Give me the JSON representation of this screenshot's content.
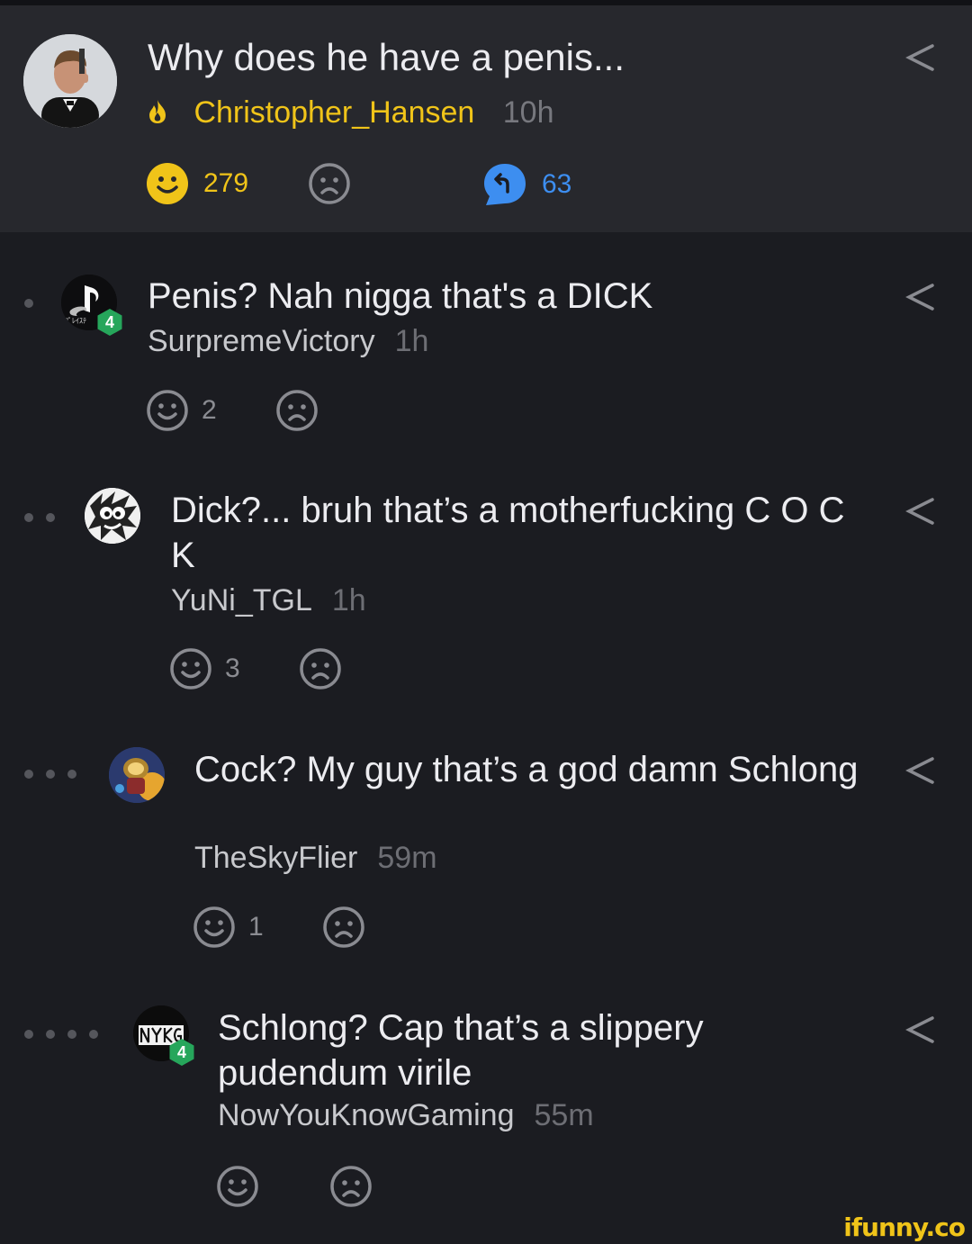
{
  "post": {
    "title": "Why does he have a penis...",
    "author": "Christopher_Hansen",
    "time": "10h",
    "smiles": "279",
    "replies": "63"
  },
  "comments": [
    {
      "text": "Penis? Nah nigga that's a DICK",
      "user": "SurpremeVictory",
      "time": "1h",
      "smiles": "2",
      "badge": "4",
      "depth": 1
    },
    {
      "text": "Dick?... bruh that’s a motherfucking C O C K",
      "user": "YuNi_TGL",
      "time": "1h",
      "smiles": "3",
      "badge": "",
      "depth": 2
    },
    {
      "text": "Cock? My guy that’s a god damn Schlong",
      "user": "TheSkyFlier",
      "time": "59m",
      "smiles": "1",
      "badge": "",
      "depth": 3
    },
    {
      "text": "Schlong? Cap that’s a slippery pudendum virile",
      "user": "NowYouKnowGaming",
      "time": "55m",
      "smiles": "",
      "badge": "4",
      "depth": 4
    }
  ],
  "watermark": "ifunny.co",
  "colors": {
    "accent": "#f0c419",
    "reply": "#3d8ef0",
    "badge": "#26a65b"
  }
}
